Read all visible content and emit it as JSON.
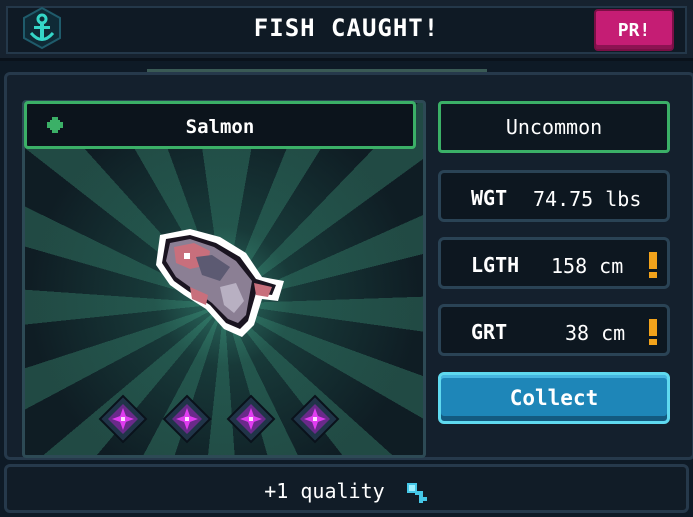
{
  "header": {
    "title": "FISH CAUGHT!",
    "badge": "PR!",
    "logo_icon": "anchor-icon"
  },
  "fish": {
    "name": "Salmon",
    "rarity": "Uncommon",
    "quality_gems": 4,
    "name_icon": "clover-icon"
  },
  "stats": {
    "weight_label": "WGT",
    "weight_value": "74.75 lbs",
    "length_label": "LGTH",
    "length_value": "158 cm",
    "girth_label": "GRT",
    "girth_value": "38 cm"
  },
  "actions": {
    "collect_label": "Collect"
  },
  "footer": {
    "quality_text": "+1 quality"
  },
  "colors": {
    "accent_green": "#3bb067",
    "collect_blue": "#1e86b8",
    "badge_pink": "#c51d74",
    "warning_orange": "#f2a31b",
    "gem_magenta": "#e13cf0"
  }
}
